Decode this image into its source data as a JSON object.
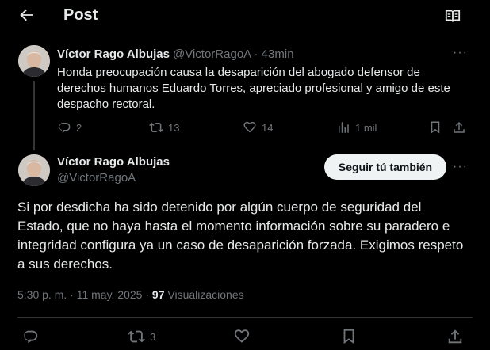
{
  "header": {
    "title": "Post"
  },
  "parent_post": {
    "author_name": "Víctor Rago Albujas",
    "author_handle": "@VictorRagoA",
    "time": "· 43min",
    "text": "Honda preocupación causa la desaparición del abogado defensor de derechos humanos Eduardo Torres, apreciado profesional y amigo de este despacho rectoral.",
    "replies": "2",
    "reposts": "13",
    "likes": "14",
    "views": "1 mil"
  },
  "main_post": {
    "author_name": "Víctor Rago Albujas",
    "author_handle": "@VictorRagoA",
    "follow_label": "Seguir tú también",
    "text": "Si por desdicha ha sido detenido por algún cuerpo de seguridad del Estado, que no haya hasta el momento información sobre su paradero e integridad configura ya un caso de desaparición forzada. Exigimos respeto a sus derechos.",
    "timestamp": "5:30 p. m. · 11 may. 2025 ·",
    "views_count": "97",
    "views_label": "Visualizaciones",
    "reposts": "3"
  },
  "colors": {
    "background": "#000000",
    "text": "#e7e9ea",
    "muted": "#71767b",
    "button_bg": "#eff3f4"
  }
}
